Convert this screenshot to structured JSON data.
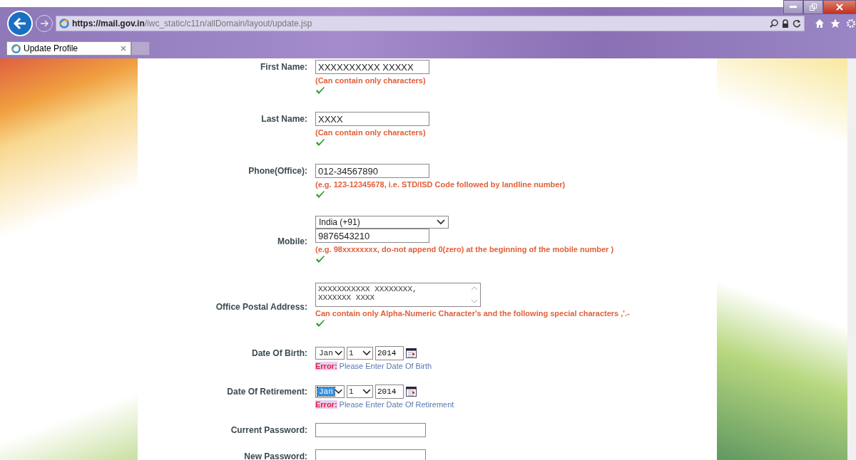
{
  "browser": {
    "url_host": "https://mail.gov.in",
    "url_path": "/iwc_static/c11n/allDomain/layout/update.jsp",
    "tab": {
      "title": "Update Profile",
      "selected": true
    }
  },
  "form": {
    "fields": [
      {
        "kind": "text",
        "label": "First Name:",
        "value": "XXXXXXXXXX XXXXX",
        "hint": "(Can contain only characters)",
        "valid": true
      },
      {
        "kind": "text",
        "label": "Last Name:",
        "value": "XXXX",
        "hint": "(Can contain only characters)",
        "valid": true
      },
      {
        "kind": "text",
        "label": "Phone(Office):",
        "value": "012-34567890",
        "hint": "(e.g. 123-12345678, i.e. STD/ISD Code followed by landline number)",
        "valid": true
      },
      {
        "kind": "mobile",
        "label": "Mobile:",
        "country": "India (+91)",
        "value": "9876543210",
        "hint": "(e.g. 98xxxxxxxx, do-not append 0(zero) at the beginning of the mobile number )",
        "valid": true
      },
      {
        "kind": "textarea",
        "label": "Office Postal Address:",
        "lines": [
          "XXXXXXXXXXX XXXXXXXX,",
          "XXXXXXX XXXX"
        ],
        "hint": "Can contain only Alpha-Numeric Character's and the following special characters ,'.-",
        "valid": true
      },
      {
        "kind": "date",
        "label": "Date Of Birth:",
        "month": "Jan",
        "day": "1",
        "year": "2014",
        "month_focused": false,
        "error_label": "Error:",
        "error": "Please Enter Date Of Birth"
      },
      {
        "kind": "date",
        "label": "Date Of Retirement:",
        "month": "Jan",
        "day": "1",
        "year": "2014",
        "month_focused": true,
        "error_label": "Error:",
        "error": "Please Enter Date Of Retirement"
      },
      {
        "kind": "password",
        "label": "Current Password:"
      },
      {
        "kind": "password",
        "label": "New Password:"
      }
    ]
  }
}
